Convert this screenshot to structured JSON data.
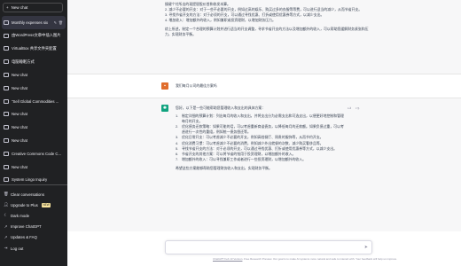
{
  "sidebar": {
    "new_chat_label": "New chat",
    "chats": [
      {
        "label": "Monthly expenses six",
        "active": true
      },
      {
        "label": "由WordPress文章中插入图片"
      },
      {
        "label": "VirtualBox 共享文件夹配置"
      },
      {
        "label": "电脑睡眠方式"
      },
      {
        "label": "New chat"
      },
      {
        "label": "New chat"
      },
      {
        "label": "\"Sell Global Commodities ..."
      },
      {
        "label": "New chat"
      },
      {
        "label": "New chat"
      },
      {
        "label": "New chat"
      },
      {
        "label": "Creative Commons Code C..."
      },
      {
        "label": "New chat"
      },
      {
        "label": "System Lingo Inquiry"
      }
    ],
    "menu": [
      {
        "label": "Clear conversations",
        "icon": "trash-icon"
      },
      {
        "label": "Upgrade to Plus",
        "badge": "NEW",
        "icon": "user-icon"
      },
      {
        "label": "Dark mode",
        "icon": "moon-icon"
      },
      {
        "label": "Improve ChatGPT",
        "icon": "external-link-icon"
      },
      {
        "label": "Updates & FAQ",
        "icon": "external-link-icon"
      },
      {
        "label": "Log out",
        "icon": "logout-icon"
      }
    ]
  },
  "conversation": {
    "top_assistant": {
      "lines": [
        "操键个付所出的现提银股价首和收发本算。",
        "2. 减少不必要的开支：对于一些不必要的开支，例如过高的娱乐、购买过多的衣服等等费，可以进行适当的减少，从而节省开支。",
        "3. 寻找节省开支的方法：对于必须的开支，可以通过寻找优惠、打折或使用优惠券等方式，以减少支出。",
        "4. 增加收入：增加额外的收入，例如兼职或投资理财，以增加财务压力。"
      ],
      "closing": "综上所述，制定一个合理的预算计划并进行适当的开支调整，寻求节省开支的方法以及增加额外的收入，可以帮助您缓解财务紧张和压力，实现财务平衡。"
    },
    "user_message": "我们每月公司的最佳方案吗",
    "assistant": {
      "intro": "您好，以下是一些可能帮助您管理收入和支出的具体方案：",
      "items": [
        "制定详细的预算计划：列出每月的收入和支出，并将支出分为必需支出和可选支出，以便更好地控制和管理每月的开支。",
        "优化债务还款策略：如果可能的话，可以考虑重新商谈债务，以降低每月的还款额。如果负债过重，可以考虑进行一次性的重组，例如统一债务偿还等。",
        "优化日常开支：可以考虑减少不必要的开支，例如高档餐厅、昂贵的服饰等，从而节约开支。",
        "优化消费习惯：可以考虑减少不必要的消费，例如减少外出就餐的次数、减少购买奢侈品等。",
        "寻找节省开支的方法：对于必须的开支，可以通过寻找优惠、打折或使用优惠券等方式，以减少支出。",
        "节省开支的其他方案：可以将节省的钱用于投资理财，以增加额外的收入。",
        "增加额外的收入：可以寻找兼职工作或者进行一些投资理财，以增加额外的收入。"
      ],
      "closing": "希望这些方案能够帮助您管理财务收入和支出，实现财务平衡。"
    }
  },
  "input": {
    "placeholder": ""
  },
  "footer": {
    "link": "ChatGPT Feb 13 Version",
    "text": ". Free Research Preview. Our goal is to make AI systems more natural and safe to interact with. Your feedback will help us improve."
  }
}
